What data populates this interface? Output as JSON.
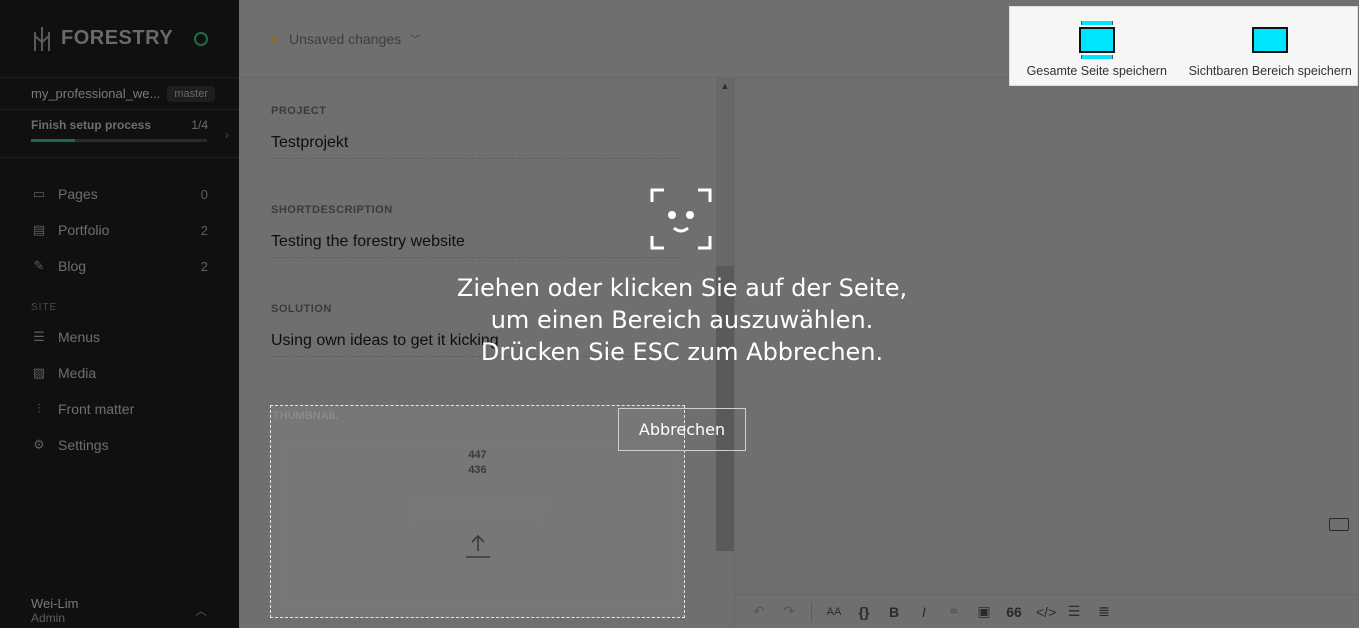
{
  "sidebar": {
    "logo_text": "FORESTRY",
    "site_name": "my_professional_we...",
    "branch": "master",
    "setup": {
      "label": "Finish setup process",
      "progress_text": "1/4",
      "progress_fraction": 0.25
    },
    "items": [
      {
        "label": "Pages",
        "count": "0",
        "icon": "page-icon"
      },
      {
        "label": "Portfolio",
        "count": "2",
        "icon": "portfolio-icon"
      },
      {
        "label": "Blog",
        "count": "2",
        "icon": "pencil-icon"
      }
    ],
    "site_section": "SITE",
    "site_items": [
      {
        "label": "Menus",
        "icon": "menu-icon"
      },
      {
        "label": "Media",
        "icon": "image-icon"
      },
      {
        "label": "Front matter",
        "icon": "sliders-icon"
      },
      {
        "label": "Settings",
        "icon": "gear-icon"
      }
    ],
    "user": {
      "name": "Wei-Lim",
      "role": "Admin"
    }
  },
  "topbar": {
    "status": "Unsaved changes"
  },
  "form": {
    "project": {
      "label": "PROJECT",
      "value": "Testprojekt"
    },
    "shortdescription": {
      "label": "SHORTDESCRIPTION",
      "value": "Testing the forestry website"
    },
    "solution": {
      "label": "SOLUTION",
      "value": "Using own ideas to get it kicking"
    },
    "thumbnail": {
      "label": "THUMBNAIL",
      "dim_w": "447",
      "dim_h": "436",
      "drop_title": "DRAG AND DROP A FILE",
      "drop_sub": "( OR CLICK TO BROWSE )"
    }
  },
  "overlay": {
    "line1": "Ziehen oder klicken Sie auf der Seite,",
    "line2": "um einen Bereich auszuwählen.",
    "line3": "Drücken Sie ESC zum Abbrechen.",
    "cancel": "Abbrechen"
  },
  "save_panel": {
    "full_page": "Gesamte Seite speichern",
    "visible_area": "Sichtbaren Bereich speichern"
  },
  "toolbar": {
    "font_size": "AA",
    "code": "{}",
    "bold": "B",
    "italic": "I",
    "quote": "66"
  },
  "colors": {
    "accent": "#00e5ff",
    "sidebar_bg": "#101010",
    "status_green": "#1e6b4a"
  }
}
